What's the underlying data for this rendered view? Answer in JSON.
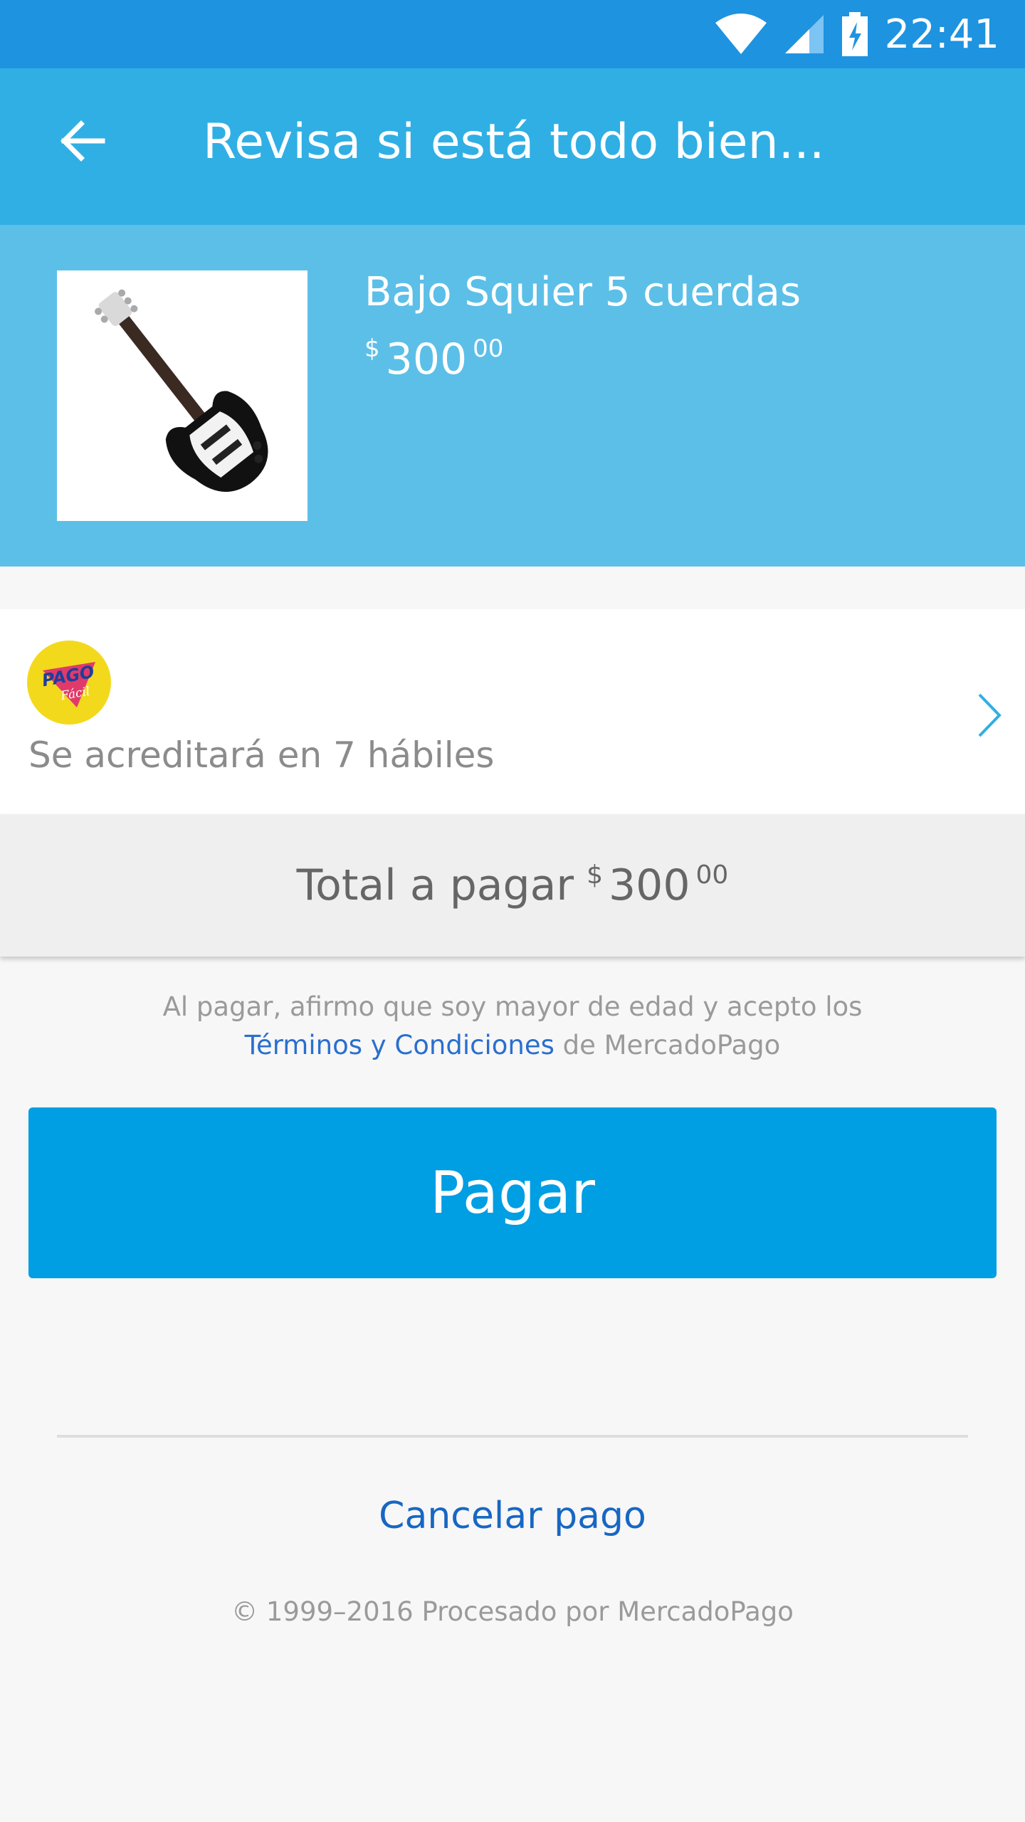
{
  "status_bar": {
    "time": "22:41"
  },
  "app_bar": {
    "title": "Revisa si está todo bien..."
  },
  "product": {
    "name": "Bajo Squier 5 cuerdas",
    "price_symbol": "$",
    "price_integer": "300",
    "price_decimal": "00"
  },
  "payment_method": {
    "logo_text_top": "PAGO",
    "logo_text_bottom": "Fácil",
    "description": "Se acreditará en 7 hábiles"
  },
  "total": {
    "label": "Total a pagar",
    "symbol": "$",
    "integer": "300",
    "decimal": "00"
  },
  "legal": {
    "line1": "Al pagar, afirmo que soy mayor de edad y acepto los",
    "link": "Términos y Condiciones",
    "suffix": " de MercadoPago"
  },
  "actions": {
    "pay_label": "Pagar",
    "cancel_label": "Cancelar pago"
  },
  "footer": {
    "copyright": "© 1999–2016 Procesado por MercadoPago"
  },
  "colors": {
    "status_bar": "#1e93e0",
    "app_bar": "#30afe4",
    "product_bg": "#5cbfe8",
    "pay_button": "#009ee3",
    "link": "#1767c3"
  }
}
